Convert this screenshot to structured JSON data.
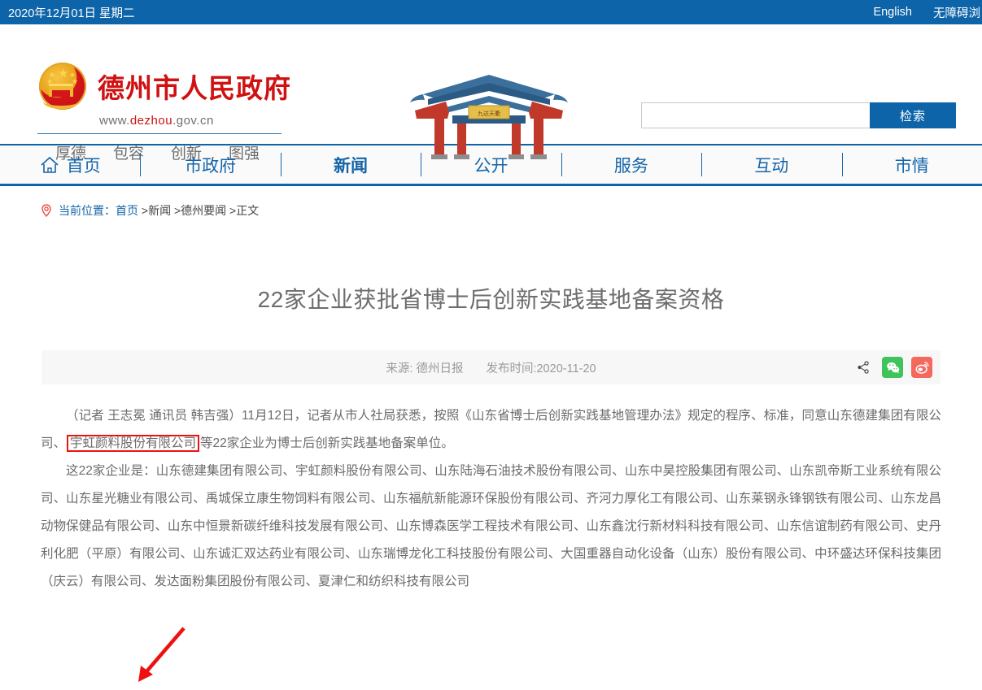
{
  "topbar": {
    "date": "2020年12月01日 星期二",
    "links": [
      "English",
      "无障碍浏"
    ]
  },
  "header": {
    "site_title": "德州市人民政府",
    "url_prefix": "www.",
    "url_highlight": "dezhou",
    "url_suffix": ".gov.cn",
    "slogan": [
      "厚德",
      "包容",
      "创新",
      "图强"
    ],
    "archway_plaque": "九达天衢",
    "search": {
      "value": "",
      "placeholder": "",
      "button_label": "检索"
    }
  },
  "nav": {
    "items": [
      {
        "label": "首页",
        "icon": "home-icon",
        "active": false
      },
      {
        "label": "市政府",
        "icon": "",
        "active": false
      },
      {
        "label": "新闻",
        "icon": "",
        "active": true
      },
      {
        "label": "公开",
        "icon": "",
        "active": false
      },
      {
        "label": "服务",
        "icon": "",
        "active": false
      },
      {
        "label": "互动",
        "icon": "",
        "active": false
      },
      {
        "label": "市情",
        "icon": "",
        "active": false
      }
    ]
  },
  "breadcrumb": {
    "icon": "location-pin-icon",
    "prefix": "当前位置：",
    "home": "首页",
    "sep1": " >",
    "level2": "新闻",
    "sep2": " >",
    "level3": "德州要闻",
    "sep3": " >",
    "current": "正文"
  },
  "article": {
    "title": "22家企业获批省博士后创新实践基地备案资格",
    "source_label": "来源:",
    "source": "德州日报",
    "source_full": "来源: 德州日报",
    "publish_full": "发布时间:2020-11-20",
    "share_icons": [
      "share-icon",
      "wechat-icon",
      "weibo-icon"
    ],
    "paragraph_1_before": "（记者 王志冕 通讯员 韩吉强）11月12日，记者从市人社局获悉，按照《山东省博士后创新实践基地管理办法》规定的程序、标准，同意山东德建集团有限公司、",
    "paragraph_1_highlight": "宇虹颜料股份有限公司",
    "paragraph_1_after": "等22家企业为博士后创新实践基地备案单位。",
    "paragraph_2": "这22家企业是：山东德建集团有限公司、宇虹颜料股份有限公司、山东陆海石油技术股份有限公司、山东中昊控股集团有限公司、山东凯帝斯工业系统有限公司、山东星光糖业有限公司、禹城保立康生物饲料有限公司、山东福航新能源环保股份有限公司、齐河力厚化工有限公司、山东莱钢永锋钢铁有限公司、山东龙昌动物保健品有限公司、山东中恒景新碳纤维科技发展有限公司、山东博森医学工程技术有限公司、山东鑫沈行新材料科技有限公司、山东信谊制药有限公司、史丹利化肥（平原）有限公司、山东诚汇双达药业有限公司、山东瑞博龙化工科技股份有限公司、大国重器自动化设备（山东）股份有限公司、中环盛达环保科技集团（庆云）有限公司、发达面粉集团股份有限公司、夏津仁和纺织科技有限公司"
  },
  "colors": {
    "brand_blue": "#0d64a8",
    "brand_red": "#cf1111",
    "highlight_red": "#ee1111",
    "wechat_green": "#3fc35a",
    "weibo_red": "#f5685d"
  }
}
